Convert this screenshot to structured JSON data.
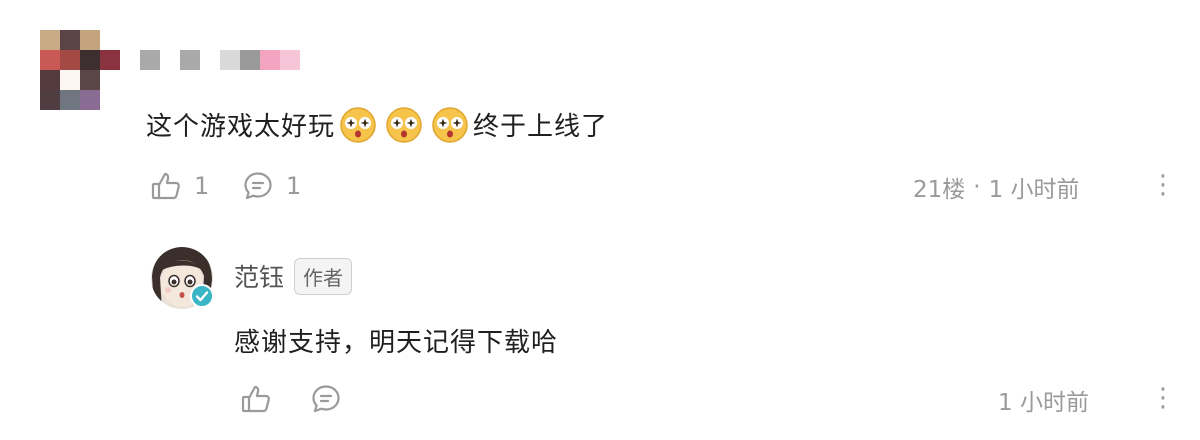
{
  "comment": {
    "avatar_colors": [
      "#c9ac86",
      "#5b4346",
      "#c3a47c",
      "#ffffff",
      "#c85955",
      "#a44a45",
      "#3d2f30",
      "#8a3240",
      "#543a3c",
      "#fdf6f2",
      "#5c4748",
      "#ffffff",
      "#4f3d41",
      "#6f767f",
      "#8a6b93",
      "#ffffff"
    ],
    "name_colors": [
      "#a9a9a9",
      "#ffffff",
      "#a9a9a9",
      "#ffffff",
      "#d9d9d9",
      "#9a9a9a",
      "#f2a4c0",
      "#f6c6d8"
    ],
    "text_before": "这个游戏太好玩",
    "emoji_name": "starstruck-face",
    "text_after": "终于上线了",
    "like_count": "1",
    "reply_count": "1",
    "floor": "21楼",
    "separator": "·",
    "time": "1 小时前",
    "more": "⋮"
  },
  "reply": {
    "author_name": "范钰",
    "author_badge": "作者",
    "verified_icon": "check-badge-icon",
    "text": "感谢支持，明天记得下载哈",
    "time": "1 小时前",
    "more": "⋮"
  },
  "colors": {
    "meta_gray": "#9a9a9a",
    "verified_teal": "#3ab5c6",
    "emoji_yellow": "#f6c44a"
  }
}
